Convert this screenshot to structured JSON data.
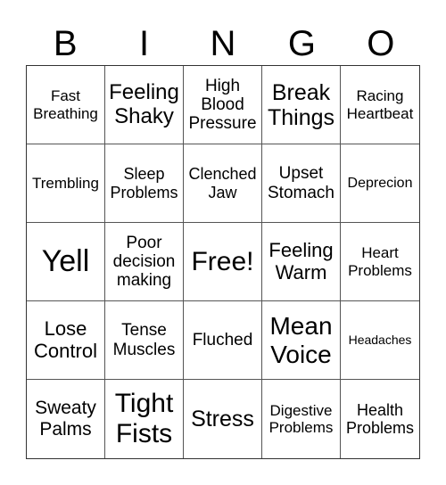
{
  "header": {
    "letters": [
      "B",
      "I",
      "N",
      "G",
      "O"
    ]
  },
  "cells": [
    {
      "text": "Fast\nBreathing"
    },
    {
      "text": "Feeling\nShaky"
    },
    {
      "text": "High\nBlood\nPressure"
    },
    {
      "text": "Break\nThings"
    },
    {
      "text": "Racing\nHeartbeat"
    },
    {
      "text": "Trembling"
    },
    {
      "text": "Sleep\nProblems"
    },
    {
      "text": "Clenched\nJaw"
    },
    {
      "text": "Upset\nStomach"
    },
    {
      "text": "Deprecion"
    },
    {
      "text": "Yell"
    },
    {
      "text": "Poor\ndecision\nmaking"
    },
    {
      "text": "Free!"
    },
    {
      "text": "Feeling\nWarm"
    },
    {
      "text": "Heart\nProblems"
    },
    {
      "text": "Lose\nControl"
    },
    {
      "text": "Tense\nMuscles"
    },
    {
      "text": "Fluched"
    },
    {
      "text": "Mean\nVoice"
    },
    {
      "text": "Headaches"
    },
    {
      "text": "Sweaty\nPalms"
    },
    {
      "text": "Tight\nFists"
    },
    {
      "text": "Stress"
    },
    {
      "text": "Digestive\nProblems"
    },
    {
      "text": "Health\nProblems"
    }
  ]
}
